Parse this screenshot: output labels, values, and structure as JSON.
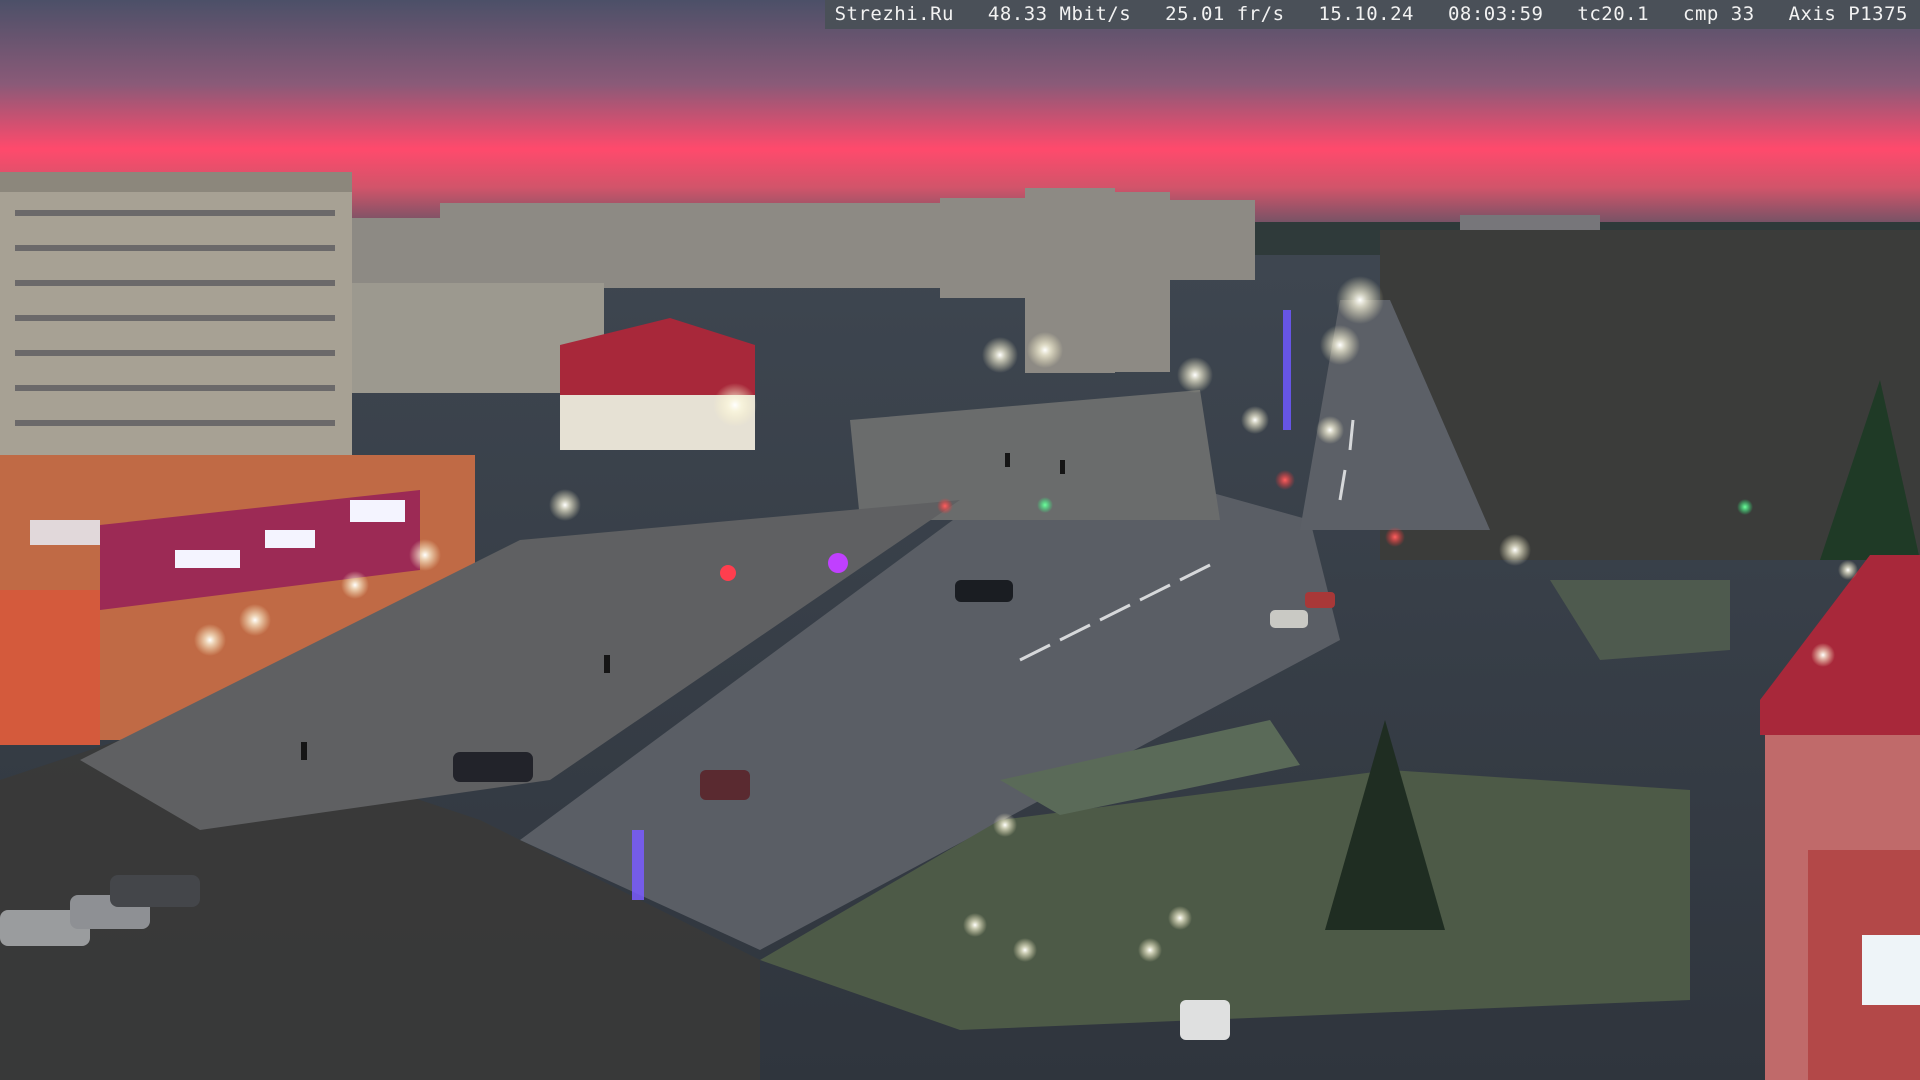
{
  "overlay": {
    "site": "Strezhi.Ru",
    "bitrate": "48.33 Mbit/s",
    "framerate": "25.01 fr/s",
    "date": "15.10.24",
    "time": "08:03:59",
    "tc": "tc20.1",
    "cmp": "cmp 33",
    "camera": "Axis P1375"
  },
  "colors": {
    "sky_top": "#4a4f66",
    "sky_glow": "#ff4a70",
    "horizon": "#3d4a5a",
    "road": "#5a5f66",
    "grass": "#4f5b48",
    "building": "#9a9488"
  }
}
